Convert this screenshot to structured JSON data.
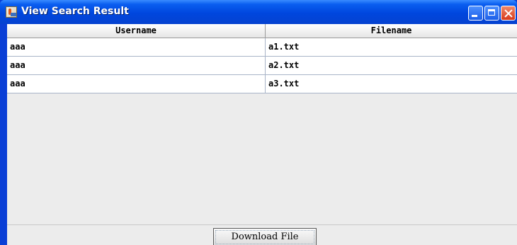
{
  "window": {
    "title": "View Search Result"
  },
  "table": {
    "columns": [
      "Username",
      "Filename"
    ],
    "rows": [
      [
        "aaa",
        "a1.txt"
      ],
      [
        "aaa",
        "a2.txt"
      ],
      [
        "aaa",
        "a3.txt"
      ]
    ]
  },
  "actions": {
    "download_label": "Download File"
  }
}
